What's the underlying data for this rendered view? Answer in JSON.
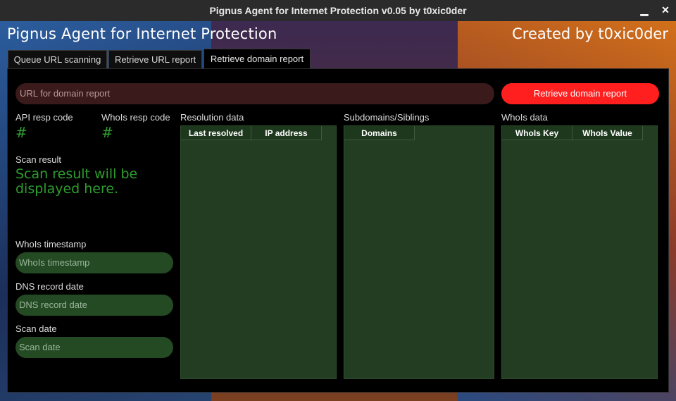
{
  "window": {
    "title": "Pignus Agent for Internet Protection v0.05 by t0xic0der",
    "minimize_glyph": "▁",
    "close_glyph": "✕"
  },
  "header": {
    "app_title": "Pignus Agent for Internet Protection",
    "creator": "Created by t0xic0der"
  },
  "tabs": [
    {
      "label": "Queue URL scanning"
    },
    {
      "label": "Retrieve URL report"
    },
    {
      "label": "Retrieve domain report"
    }
  ],
  "url_input": {
    "placeholder": "URL for domain report"
  },
  "retrieve_button": {
    "label": "Retrieve domain report"
  },
  "api_resp": {
    "label": "API resp code",
    "value": "#"
  },
  "whois_resp": {
    "label": "WhoIs resp code",
    "value": "#"
  },
  "scan_result": {
    "label": "Scan result",
    "value": "Scan result will be displayed here."
  },
  "whois_timestamp": {
    "label": "WhoIs timestamp",
    "placeholder": "WhoIs timestamp"
  },
  "dns_record_date": {
    "label": "DNS record date",
    "placeholder": "DNS record date"
  },
  "scan_date": {
    "label": "Scan date",
    "placeholder": "Scan date"
  },
  "resolution": {
    "label": "Resolution data",
    "columns": [
      "Last resolved",
      "IP address"
    ]
  },
  "subdomains": {
    "label": "Subdomains/Siblings",
    "columns": [
      "Domains"
    ]
  },
  "whois_data": {
    "label": "WhoIs data",
    "columns": [
      "WhoIs Key",
      "WhoIs Value"
    ]
  },
  "colors": {
    "accent": "#ff1f1f",
    "green_text": "#2e9e2e",
    "table_bg": "#223d22"
  }
}
